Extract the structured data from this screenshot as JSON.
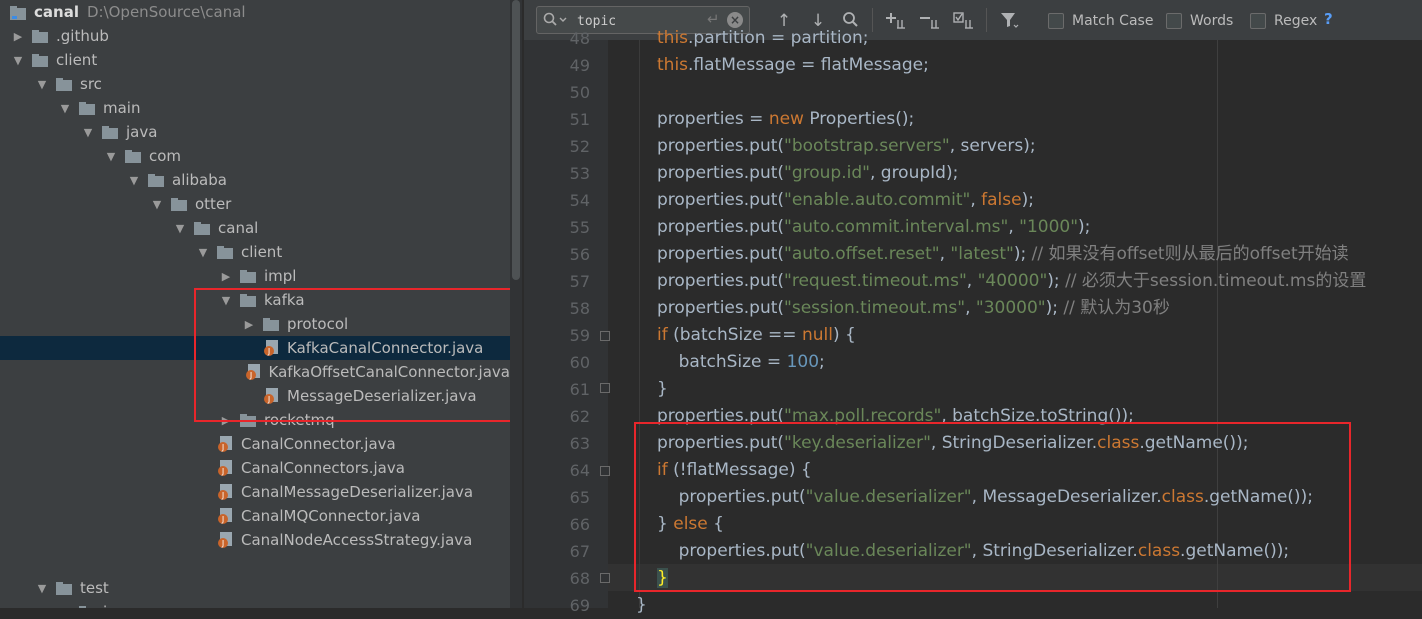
{
  "project": {
    "name": "canal",
    "path": "D:\\OpenSource\\canal"
  },
  "tree": [
    {
      "label": ".github",
      "type": "folder",
      "arrow": "right"
    },
    {
      "label": "client",
      "type": "folder",
      "arrow": "down"
    },
    {
      "label": "src",
      "type": "folder",
      "arrow": "down"
    },
    {
      "label": "main",
      "type": "folder",
      "arrow": "down"
    },
    {
      "label": "java",
      "type": "folder",
      "arrow": "down"
    },
    {
      "label": "com",
      "type": "folder",
      "arrow": "down"
    },
    {
      "label": "alibaba",
      "type": "folder",
      "arrow": "down"
    },
    {
      "label": "otter",
      "type": "folder",
      "arrow": "down"
    },
    {
      "label": "canal",
      "type": "folder",
      "arrow": "down"
    },
    {
      "label": "client",
      "type": "folder",
      "arrow": "down"
    },
    {
      "label": "impl",
      "type": "folder",
      "arrow": "right"
    },
    {
      "label": "kafka",
      "type": "folder",
      "arrow": "down"
    },
    {
      "label": "protocol",
      "type": "folder",
      "arrow": "right"
    },
    {
      "label": "KafkaCanalConnector.java",
      "type": "java",
      "selected": true
    },
    {
      "label": "KafkaOffsetCanalConnector.java",
      "type": "java"
    },
    {
      "label": "MessageDeserializer.java",
      "type": "java"
    },
    {
      "label": "rocketmq",
      "type": "folder",
      "arrow": "right"
    },
    {
      "label": "CanalConnector.java",
      "type": "java"
    },
    {
      "label": "CanalConnectors.java",
      "type": "java"
    },
    {
      "label": "CanalMessageDeserializer.java",
      "type": "java"
    },
    {
      "label": "CanalMQConnector.java",
      "type": "java"
    },
    {
      "label": "CanalNodeAccessStrategy.java",
      "type": "java"
    },
    {
      "label": "",
      "type": "blank"
    },
    {
      "label": "test",
      "type": "folder",
      "arrow": "down"
    },
    {
      "label": "java",
      "type": "folder",
      "arrow": "down"
    }
  ],
  "find": {
    "query": "topic",
    "match_case": "Match Case",
    "words": "Words",
    "regex": "Regex",
    "help": "?"
  },
  "editor": {
    "current_line": "68",
    "lines": [
      {
        "n": "48",
        "code": "this.partition = partition;"
      },
      {
        "n": "49",
        "code": "this.flatMessage = flatMessage;"
      },
      {
        "n": "50",
        "code": ""
      },
      {
        "n": "51",
        "code": "properties = new Properties();"
      },
      {
        "n": "52",
        "code": "properties.put(\"bootstrap.servers\", servers);"
      },
      {
        "n": "53",
        "code": "properties.put(\"group.id\", groupId);"
      },
      {
        "n": "54",
        "code": "properties.put(\"enable.auto.commit\", false);"
      },
      {
        "n": "55",
        "code": "properties.put(\"auto.commit.interval.ms\", \"1000\");"
      },
      {
        "n": "56",
        "code": "properties.put(\"auto.offset.reset\", \"latest\"); // 如果没有offset则从最后的offset开始读"
      },
      {
        "n": "57",
        "code": "properties.put(\"request.timeout.ms\", \"40000\"); // 必须大于session.timeout.ms的设置"
      },
      {
        "n": "58",
        "code": "properties.put(\"session.timeout.ms\", \"30000\"); // 默认为30秒"
      },
      {
        "n": "59",
        "code": "if (batchSize == null) {"
      },
      {
        "n": "60",
        "code": "    batchSize = 100;"
      },
      {
        "n": "61",
        "code": "}"
      },
      {
        "n": "62",
        "code": "properties.put(\"max.poll.records\", batchSize.toString());"
      },
      {
        "n": "63",
        "code": "properties.put(\"key.deserializer\", StringDeserializer.class.getName());"
      },
      {
        "n": "64",
        "code": "if (!flatMessage) {"
      },
      {
        "n": "65",
        "code": "    properties.put(\"value.deserializer\", MessageDeserializer.class.getName());"
      },
      {
        "n": "66",
        "code": "} else {"
      },
      {
        "n": "67",
        "code": "    properties.put(\"value.deserializer\", StringDeserializer.class.getName());"
      },
      {
        "n": "68",
        "code": "}"
      },
      {
        "n": "69",
        "code": "}"
      }
    ]
  },
  "colors": {
    "keyword": "#cc7832",
    "string": "#6a8759",
    "number": "#6897bb",
    "comment": "#808080",
    "text": "#a9b7c6",
    "highlight_box": "#e8262b",
    "selection": "#0d293e"
  }
}
